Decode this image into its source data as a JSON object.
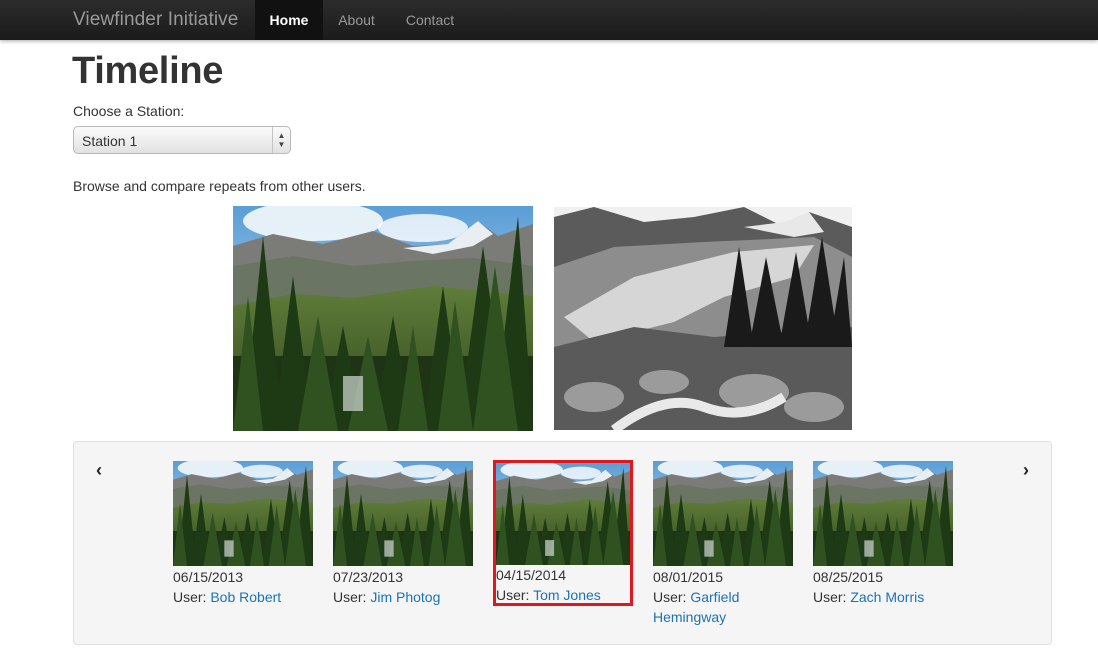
{
  "navbar": {
    "brand": "Viewfinder Initiative",
    "items": [
      {
        "label": "Home",
        "active": true
      },
      {
        "label": "About",
        "active": false
      },
      {
        "label": "Contact",
        "active": false
      }
    ]
  },
  "page": {
    "title": "Timeline",
    "station_label": "Choose a Station:",
    "station_selected": "Station 1",
    "intro": "Browse and compare repeats from other users."
  },
  "carousel": {
    "prev_icon": "chevron-left-icon",
    "next_icon": "chevron-right-icon",
    "user_prefix": "User:",
    "selected_index": 2,
    "items": [
      {
        "date": "06/15/2013",
        "user": "Bob Robert"
      },
      {
        "date": "07/23/2013",
        "user": "Jim Photog"
      },
      {
        "date": "04/15/2014",
        "user": "Tom Jones"
      },
      {
        "date": "08/01/2015",
        "user": "Garfield Hemingway"
      },
      {
        "date": "08/25/2015",
        "user": "Zach Morris"
      }
    ]
  },
  "colors": {
    "accent_link": "#1a73b8",
    "selected_border": "#e0171d",
    "navbar_bg": "#1b1b1b"
  }
}
